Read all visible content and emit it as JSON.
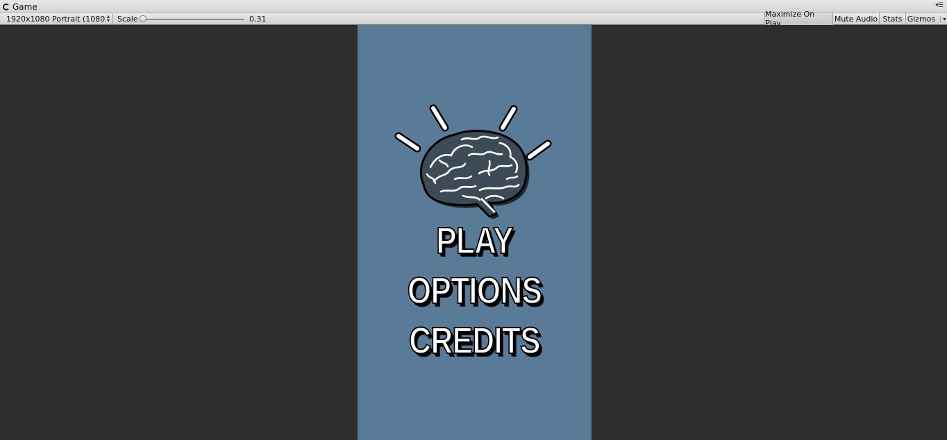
{
  "window": {
    "tab_title": "Game",
    "tab_icon": "unity-game-icon"
  },
  "toolbar": {
    "resolution_selected": "1920x1080 Portrait (1080x",
    "scale_label": "Scale",
    "scale_value": "0.31",
    "scale_slider_fraction": 0.0,
    "buttons": {
      "maximize_on_play": "Maximize On Play",
      "mute_audio": "Mute Audio",
      "stats": "Stats",
      "gizmos": "Gizmos"
    }
  },
  "game": {
    "background_color": "#5a7b97",
    "logo_icon": "brain-lightbulb-icon",
    "menu": {
      "play": "PLAY",
      "options": "OPTIONS",
      "credits": "CREDITS"
    }
  }
}
